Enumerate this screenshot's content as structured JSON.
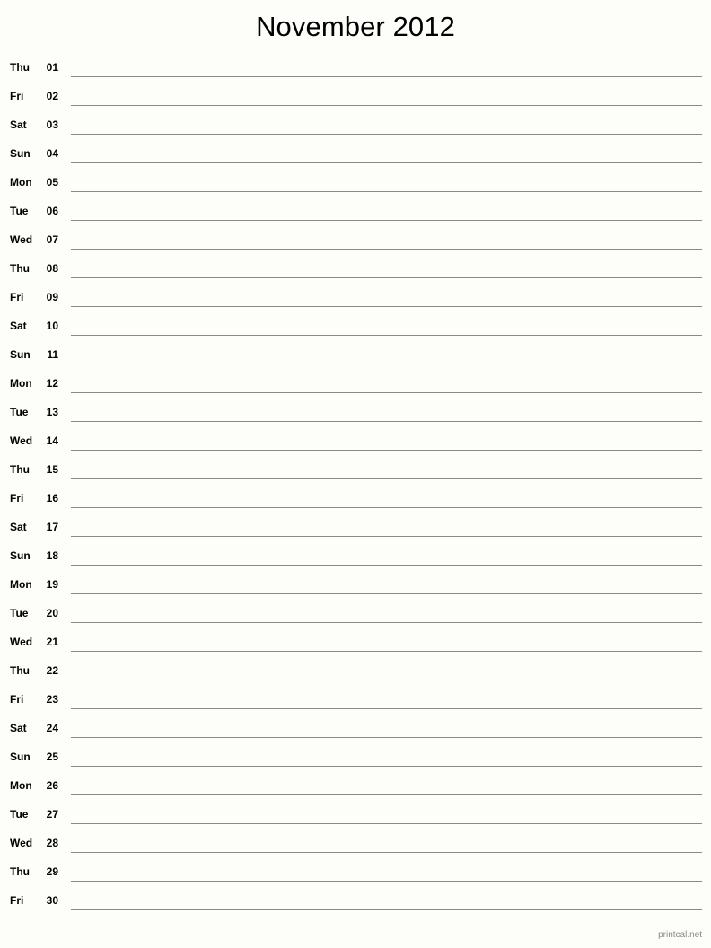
{
  "page": {
    "title": "November 2012",
    "month_name": "November",
    "year": "2012",
    "background_color": "#fdfdfa",
    "text_color": "#000000",
    "line_color": "#8a8a8a"
  },
  "footer": {
    "credit": "printcal.net",
    "color": "#8a8a8a"
  },
  "days": [
    {
      "weekday": "Thu",
      "date": "01"
    },
    {
      "weekday": "Fri",
      "date": "02"
    },
    {
      "weekday": "Sat",
      "date": "03"
    },
    {
      "weekday": "Sun",
      "date": "04"
    },
    {
      "weekday": "Mon",
      "date": "05"
    },
    {
      "weekday": "Tue",
      "date": "06"
    },
    {
      "weekday": "Wed",
      "date": "07"
    },
    {
      "weekday": "Thu",
      "date": "08"
    },
    {
      "weekday": "Fri",
      "date": "09"
    },
    {
      "weekday": "Sat",
      "date": "10"
    },
    {
      "weekday": "Sun",
      "date": "11"
    },
    {
      "weekday": "Mon",
      "date": "12"
    },
    {
      "weekday": "Tue",
      "date": "13"
    },
    {
      "weekday": "Wed",
      "date": "14"
    },
    {
      "weekday": "Thu",
      "date": "15"
    },
    {
      "weekday": "Fri",
      "date": "16"
    },
    {
      "weekday": "Sat",
      "date": "17"
    },
    {
      "weekday": "Sun",
      "date": "18"
    },
    {
      "weekday": "Mon",
      "date": "19"
    },
    {
      "weekday": "Tue",
      "date": "20"
    },
    {
      "weekday": "Wed",
      "date": "21"
    },
    {
      "weekday": "Thu",
      "date": "22"
    },
    {
      "weekday": "Fri",
      "date": "23"
    },
    {
      "weekday": "Sat",
      "date": "24"
    },
    {
      "weekday": "Sun",
      "date": "25"
    },
    {
      "weekday": "Mon",
      "date": "26"
    },
    {
      "weekday": "Tue",
      "date": "27"
    },
    {
      "weekday": "Wed",
      "date": "28"
    },
    {
      "weekday": "Thu",
      "date": "29"
    },
    {
      "weekday": "Fri",
      "date": "30"
    }
  ]
}
